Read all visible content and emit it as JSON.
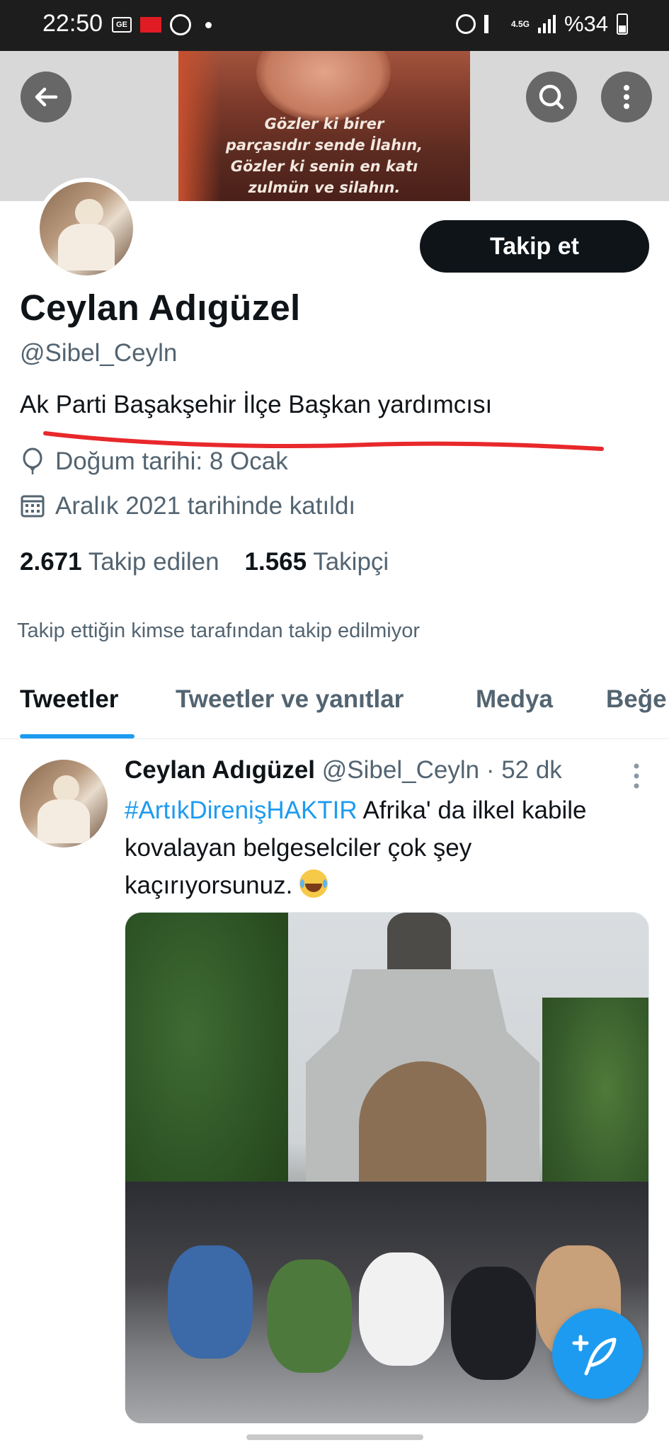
{
  "status_bar": {
    "time": "22:50",
    "network": "4.5G",
    "battery": "%34"
  },
  "banner": {
    "caption_lines": [
      "Gözler ki birer",
      "parçasıdır sende İlahın,",
      "Gözler ki senin en katı",
      "zulmün ve silahın."
    ]
  },
  "header_buttons": {
    "back_icon": "arrow-left-icon",
    "search_icon": "search-icon",
    "more_icon": "more-vertical-icon"
  },
  "profile": {
    "follow_label": "Takip et",
    "display_name": "Ceylan Adıgüzel",
    "handle": "@Sibel_Ceyln",
    "bio": "Ak Parti Başakşehir İlçe Başkan yardımcısı",
    "birth": "Doğum tarihi: 8 Ocak",
    "joined": "Aralık 2021 tarihinde katıldı",
    "following_count": "2.671",
    "following_label": "Takip edilen",
    "followers_count": "1.565",
    "followers_label": "Takipçi",
    "not_followed": "Takip ettiğin kimse tarafından takip edilmiyor"
  },
  "tabs": [
    {
      "label": "Tweetler",
      "active": true
    },
    {
      "label": "Tweetler ve yanıtlar",
      "active": false
    },
    {
      "label": "Medya",
      "active": false
    },
    {
      "label": "Beğe",
      "active": false
    }
  ],
  "tweet": {
    "name": "Ceylan Adıgüzel",
    "handle": "@Sibel_Ceyln",
    "time": "· 52 dk",
    "hashtag": "#ArtıkDirenişHAKTIR",
    "text_1": " Afrika' da ilkel kabile kovalayan belgeselciler çok şey kaçırıyorsunuz. ",
    "emoji": "face-with-tears-of-joy"
  },
  "colors": {
    "accent": "#1d9bf0",
    "text_primary": "#0f1419",
    "text_secondary": "#536471",
    "underline_annotation": "#e8282b"
  }
}
